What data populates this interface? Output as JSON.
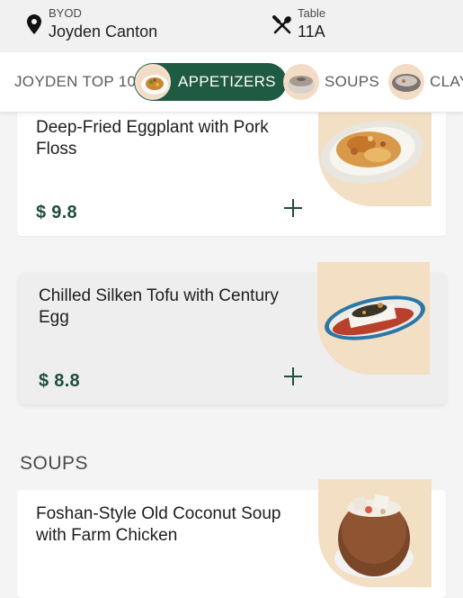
{
  "header": {
    "location_label": "BYOD",
    "location_name": "Joyden Canton",
    "table_label": "Table",
    "table_number": "11A"
  },
  "categories": [
    {
      "label": "JOYDEN TOP 10",
      "icon": "none",
      "active": false
    },
    {
      "label": "APPETIZERS",
      "icon": "appetizer-dish-thumbnail",
      "active": true
    },
    {
      "label": "SOUPS",
      "icon": "soup-pot-thumbnail",
      "active": false
    },
    {
      "label": "CLAY",
      "icon": "claypot-thumbnail",
      "active": false
    }
  ],
  "items": [
    {
      "name": "Deep-Fried Eggplant with Pork Floss",
      "price": "$ 9.8",
      "image": "fried-eggplant-photo"
    },
    {
      "name": "Chilled Silken Tofu with Century Egg",
      "price": "$ 8.8",
      "image": "silken-tofu-photo"
    },
    {
      "name": "Foshan-Style Old Coconut Soup with Farm Chicken",
      "price": "",
      "image": "coconut-soup-photo"
    }
  ],
  "sections": {
    "soups_title": "SOUPS"
  },
  "colors": {
    "brand_green": "#1f5a43",
    "price_green": "#1f4f3a",
    "image_bg": "#f3dfc4"
  }
}
